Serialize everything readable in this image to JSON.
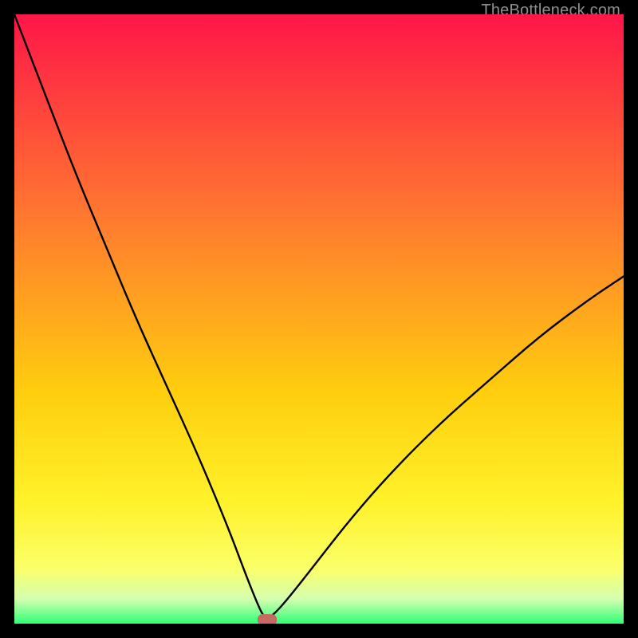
{
  "watermark": "TheBottleneck.com",
  "chart_data": {
    "type": "line",
    "title": "",
    "xlabel": "",
    "ylabel": "",
    "xlim": [
      0,
      100
    ],
    "ylim": [
      0,
      100
    ],
    "legend": false,
    "grid": false,
    "background_gradient": [
      "#ff1648",
      "#ff9b29",
      "#ffe009",
      "#fcff4a",
      "#2fff76"
    ],
    "series": [
      {
        "name": "bottleneck-curve",
        "color": "#000000",
        "x": [
          0,
          5,
          10,
          15,
          20,
          25,
          30,
          35,
          38,
          40,
          41,
          42,
          44,
          48,
          55,
          62,
          70,
          78,
          86,
          94,
          100
        ],
        "y": [
          100,
          87,
          74,
          62,
          50,
          39,
          28,
          16,
          8,
          3,
          1,
          1,
          3,
          8,
          17,
          25,
          33,
          40,
          47,
          53,
          57
        ]
      }
    ],
    "marker": {
      "name": "optimal-point",
      "x": 41.5,
      "y": 0.5,
      "color": "#c76a62",
      "shape": "rounded-rect"
    }
  }
}
